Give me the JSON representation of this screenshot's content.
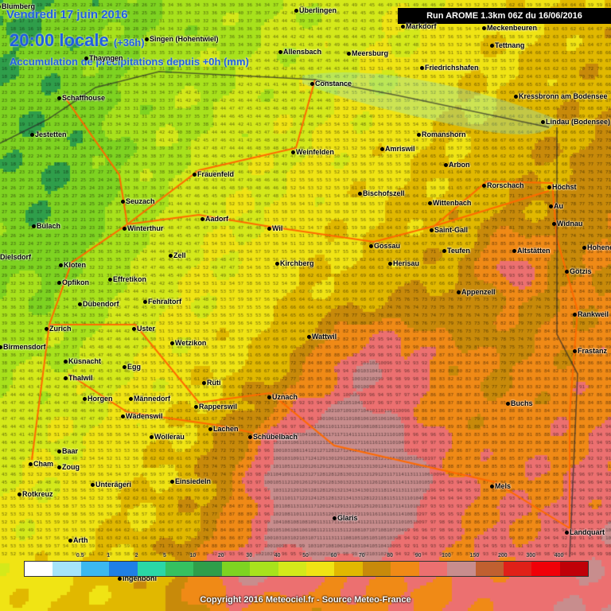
{
  "header": {
    "date": "Vendredi 17 juin 2016",
    "time": "20:00 locale",
    "lead": "(+36h)",
    "title": "Accumulation de précipitations depuis +0h (mm)",
    "run": "Run AROME 1.3km 06Z du 16/06/2016"
  },
  "places": [
    {
      "name": "Blumberg"
    },
    {
      "name": "Überlingen"
    },
    {
      "name": "Markdorf"
    },
    {
      "name": "Meckenbeuren"
    },
    {
      "name": "Singen (Hohentwiel)"
    },
    {
      "name": "Allensbach"
    },
    {
      "name": "Tettnang"
    },
    {
      "name": "Meersburg"
    },
    {
      "name": "Thayngen"
    },
    {
      "name": "Friedrichshafen"
    },
    {
      "name": "Constance"
    },
    {
      "name": "Kressbronn am Bodensee"
    },
    {
      "name": "Schaffhouse"
    },
    {
      "name": "Lindau (Bodensee)"
    },
    {
      "name": "Romanshorn"
    },
    {
      "name": "Jestetten"
    },
    {
      "name": "Weinfelden"
    },
    {
      "name": "Amriswil"
    },
    {
      "name": "Arbon"
    },
    {
      "name": "Frauenfeld"
    },
    {
      "name": "Rorschach"
    },
    {
      "name": "Höchst"
    },
    {
      "name": "Bischofszell"
    },
    {
      "name": "Seuzach"
    },
    {
      "name": "Wittenbach"
    },
    {
      "name": "Au"
    },
    {
      "name": "Aadorf"
    },
    {
      "name": "Bülach"
    },
    {
      "name": "Winterthur"
    },
    {
      "name": "Wil"
    },
    {
      "name": "Saint-Gall"
    },
    {
      "name": "Widnau"
    },
    {
      "name": "Gossau"
    },
    {
      "name": "Dielsdorf"
    },
    {
      "name": "Zell"
    },
    {
      "name": "Teufen"
    },
    {
      "name": "Altstätten"
    },
    {
      "name": "Hohenems"
    },
    {
      "name": "Kloten"
    },
    {
      "name": "Kirchberg"
    },
    {
      "name": "Herisau"
    },
    {
      "name": "Opfikon"
    },
    {
      "name": "Effretikon"
    },
    {
      "name": "Götzis"
    },
    {
      "name": "Appenzell"
    },
    {
      "name": "Dübendorf"
    },
    {
      "name": "Fehraltorf"
    },
    {
      "name": "Rankweil"
    },
    {
      "name": "Zurich"
    },
    {
      "name": "Uster"
    },
    {
      "name": "Wattwil"
    },
    {
      "name": "Birmensdorf"
    },
    {
      "name": "Wetzikon"
    },
    {
      "name": "Frastanz"
    },
    {
      "name": "Küsnacht"
    },
    {
      "name": "Egg"
    },
    {
      "name": "Thalwil"
    },
    {
      "name": "Rüti"
    },
    {
      "name": "Uznach"
    },
    {
      "name": "Horgen"
    },
    {
      "name": "Männedorf"
    },
    {
      "name": "Rapperswil"
    },
    {
      "name": "Buchs"
    },
    {
      "name": "Wädenswil"
    },
    {
      "name": "Lachen"
    },
    {
      "name": "Wollerau"
    },
    {
      "name": "Schübelbach"
    },
    {
      "name": "Baar"
    },
    {
      "name": "Cham"
    },
    {
      "name": "Zoug"
    },
    {
      "name": "Unterägeri"
    },
    {
      "name": "Einsiedeln"
    },
    {
      "name": "Mels"
    },
    {
      "name": "Rotkreuz"
    },
    {
      "name": "Glaris"
    },
    {
      "name": "Landquart"
    },
    {
      "name": "Arth"
    },
    {
      "name": "Ingenbohl"
    }
  ],
  "legend": {
    "ticks": [
      "0.5",
      "1",
      "2",
      "5",
      "10",
      "20",
      "30",
      "40",
      "50",
      "60",
      "70",
      "80",
      "90",
      "100",
      "150",
      "200",
      "300",
      "400"
    ],
    "colors": [
      "#ffffff",
      "#a6e4f9",
      "#3bb8f0",
      "#1f7fe6",
      "#2ad7a6",
      "#35c160",
      "#2f9e4a",
      "#7ed321",
      "#a8e21c",
      "#d4e91a",
      "#f0e414",
      "#e1b800",
      "#c88a0a",
      "#f08a16",
      "#ec7070",
      "#c88d8d",
      "#c06030",
      "#e02018",
      "#f00008",
      "#c00008"
    ]
  },
  "copyright": "Copyright 2016 Meteociel.fr - Source Meteo-France"
}
